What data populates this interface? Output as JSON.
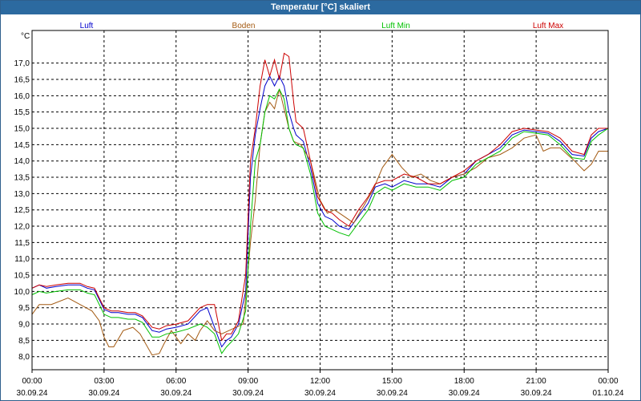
{
  "window": {
    "title": "Temperatur [°C] skaliert"
  },
  "chart_data": {
    "type": "line",
    "title": "Temperatur [°C] skaliert",
    "ylabel": "°C",
    "xlabel": "",
    "ylim": [
      7.6,
      18.0
    ],
    "xlim": [
      0,
      24
    ],
    "grid": true,
    "legend_position": "top",
    "yticks": [
      8.0,
      8.5,
      9.0,
      9.5,
      10.0,
      10.5,
      11.0,
      11.5,
      12.0,
      12.5,
      13.0,
      13.5,
      14.0,
      14.5,
      15.0,
      15.5,
      16.0,
      16.5,
      17.0
    ],
    "ytick_labels": [
      "8,0",
      "8,5",
      "9,0",
      "9,5",
      "10,0",
      "10,5",
      "11,0",
      "11,5",
      "12,0",
      "12,5",
      "13,0",
      "13,5",
      "14,0",
      "14,5",
      "15,0",
      "15,5",
      "16,0",
      "16,5",
      "17,0"
    ],
    "xticks": [
      {
        "time": "00:00",
        "date": "30.09.24"
      },
      {
        "time": "03:00",
        "date": "30.09.24"
      },
      {
        "time": "06:00",
        "date": "30.09.24"
      },
      {
        "time": "09:00",
        "date": "30.09.24"
      },
      {
        "time": "12:00",
        "date": "30.09.24"
      },
      {
        "time": "15:00",
        "date": "30.09.24"
      },
      {
        "time": "18:00",
        "date": "30.09.24"
      },
      {
        "time": "21:00",
        "date": "30.09.24"
      },
      {
        "time": "00:00",
        "date": "01.10.24"
      }
    ],
    "series": [
      {
        "name": "Luft",
        "color": "#0000cc",
        "x": [
          0,
          0.3,
          0.6,
          1.0,
          1.5,
          2.0,
          2.3,
          2.6,
          3.0,
          3.3,
          3.6,
          4.0,
          4.3,
          4.6,
          5.0,
          5.3,
          5.6,
          6.0,
          6.5,
          7.0,
          7.3,
          7.6,
          7.9,
          8.1,
          8.3,
          8.6,
          8.9,
          9.1,
          9.3,
          9.5,
          9.7,
          9.9,
          10.1,
          10.3,
          10.5,
          10.7,
          10.9,
          11.0,
          11.3,
          11.6,
          11.9,
          12.2,
          12.5,
          12.8,
          13.2,
          13.6,
          14.0,
          14.3,
          14.7,
          15.0,
          15.5,
          16.0,
          16.5,
          17.0,
          17.5,
          18.0,
          18.5,
          19.0,
          19.5,
          20.0,
          20.5,
          21.0,
          21.5,
          22.0,
          22.5,
          23.0,
          23.3,
          23.6,
          24.0
        ],
        "y": [
          10.1,
          10.2,
          10.1,
          10.15,
          10.2,
          10.2,
          10.1,
          10.05,
          9.45,
          9.35,
          9.35,
          9.3,
          9.3,
          9.2,
          8.8,
          8.75,
          8.85,
          8.9,
          9.0,
          9.4,
          9.5,
          8.9,
          8.3,
          8.5,
          8.6,
          9.0,
          10.0,
          13.5,
          14.8,
          15.6,
          16.3,
          16.6,
          16.3,
          16.6,
          16.3,
          15.5,
          15.0,
          14.8,
          14.6,
          13.8,
          12.7,
          12.3,
          12.2,
          12.0,
          11.9,
          12.3,
          12.7,
          13.2,
          13.3,
          13.2,
          13.4,
          13.3,
          13.3,
          13.2,
          13.5,
          13.6,
          14.0,
          14.2,
          14.4,
          14.8,
          14.95,
          14.9,
          14.85,
          14.6,
          14.2,
          14.15,
          14.7,
          14.9,
          15.0
        ]
      },
      {
        "name": "Boden",
        "color": "#a35a12",
        "x": [
          0,
          0.3,
          0.8,
          1.5,
          2.0,
          2.5,
          2.8,
          3.0,
          3.2,
          3.4,
          3.8,
          4.2,
          4.5,
          5.0,
          5.3,
          5.5,
          5.8,
          6.0,
          6.2,
          6.5,
          6.8,
          7.0,
          7.3,
          7.6,
          7.9,
          8.2,
          8.5,
          8.8,
          9.1,
          9.3,
          9.5,
          9.7,
          9.9,
          10.1,
          10.3,
          10.5,
          10.7,
          10.9,
          11.2,
          11.6,
          12.0,
          12.3,
          12.6,
          13.0,
          13.4,
          13.8,
          14.2,
          14.6,
          15.0,
          15.4,
          15.8,
          16.2,
          16.6,
          17.0,
          17.5,
          18.0,
          18.5,
          19.0,
          19.5,
          20.0,
          20.5,
          21.0,
          21.3,
          21.6,
          22.0,
          22.3,
          22.6,
          23.0,
          23.3,
          23.6,
          24.0
        ],
        "y": [
          9.3,
          9.6,
          9.6,
          9.8,
          9.6,
          9.4,
          9.1,
          8.6,
          8.3,
          8.3,
          8.8,
          8.9,
          8.7,
          8.05,
          8.1,
          8.4,
          8.8,
          8.6,
          8.4,
          8.7,
          8.5,
          8.8,
          9.1,
          8.8,
          8.7,
          8.8,
          8.9,
          9.0,
          11.5,
          12.8,
          14.5,
          15.5,
          15.8,
          15.6,
          16.2,
          15.6,
          15.0,
          14.6,
          14.5,
          14.0,
          12.8,
          12.4,
          12.5,
          12.3,
          12.1,
          12.6,
          13.1,
          13.8,
          14.2,
          13.8,
          13.5,
          13.6,
          13.4,
          13.3,
          13.5,
          13.6,
          13.8,
          14.1,
          14.2,
          14.4,
          14.7,
          14.8,
          14.3,
          14.4,
          14.4,
          14.2,
          14.0,
          13.7,
          13.9,
          14.3,
          14.3
        ]
      },
      {
        "name": "Luft Min",
        "color": "#00c000",
        "x": [
          0,
          0.3,
          0.6,
          1.0,
          1.5,
          2.0,
          2.3,
          2.6,
          3.0,
          3.3,
          3.6,
          4.0,
          4.3,
          4.6,
          5.0,
          5.3,
          5.6,
          6.0,
          6.5,
          7.0,
          7.3,
          7.6,
          7.9,
          8.1,
          8.3,
          8.6,
          8.9,
          9.1,
          9.3,
          9.5,
          9.7,
          9.9,
          10.1,
          10.3,
          10.5,
          10.7,
          10.9,
          11.0,
          11.3,
          11.6,
          11.9,
          12.2,
          12.5,
          12.8,
          13.2,
          13.6,
          14.0,
          14.3,
          14.7,
          15.0,
          15.5,
          16.0,
          16.5,
          17.0,
          17.5,
          18.0,
          18.5,
          19.0,
          19.5,
          20.0,
          20.5,
          21.0,
          21.5,
          22.0,
          22.5,
          23.0,
          23.3,
          23.6,
          24.0
        ],
        "y": [
          9.9,
          10.0,
          9.95,
          10.0,
          10.05,
          10.05,
          9.95,
          9.9,
          9.3,
          9.2,
          9.2,
          9.15,
          9.15,
          9.05,
          8.6,
          8.6,
          8.7,
          8.75,
          8.85,
          9.0,
          8.9,
          8.7,
          8.1,
          8.3,
          8.45,
          8.7,
          9.4,
          12.0,
          14.0,
          14.5,
          15.5,
          16.0,
          15.9,
          16.2,
          15.9,
          15.0,
          14.6,
          14.5,
          14.4,
          13.6,
          12.4,
          12.0,
          11.9,
          11.8,
          11.7,
          12.1,
          12.5,
          13.0,
          13.2,
          13.1,
          13.3,
          13.2,
          13.2,
          13.1,
          13.4,
          13.5,
          13.9,
          14.1,
          14.3,
          14.7,
          14.9,
          14.85,
          14.8,
          14.5,
          14.1,
          14.05,
          14.6,
          14.8,
          15.0
        ]
      },
      {
        "name": "Luft Max",
        "color": "#cc0000",
        "x": [
          0,
          0.3,
          0.6,
          1.0,
          1.5,
          2.0,
          2.3,
          2.6,
          3.0,
          3.3,
          3.6,
          4.0,
          4.3,
          4.6,
          5.0,
          5.3,
          5.6,
          6.0,
          6.5,
          7.0,
          7.3,
          7.6,
          7.9,
          8.1,
          8.3,
          8.6,
          8.9,
          9.1,
          9.3,
          9.5,
          9.7,
          9.9,
          10.1,
          10.3,
          10.5,
          10.7,
          10.9,
          11.0,
          11.3,
          11.6,
          11.9,
          12.2,
          12.5,
          12.8,
          13.2,
          13.6,
          14.0,
          14.3,
          14.7,
          15.0,
          15.5,
          16.0,
          16.5,
          17.0,
          17.5,
          18.0,
          18.5,
          19.0,
          19.5,
          20.0,
          20.5,
          21.0,
          21.5,
          22.0,
          22.5,
          23.0,
          23.3,
          23.6,
          24.0
        ],
        "y": [
          10.1,
          10.2,
          10.15,
          10.2,
          10.25,
          10.25,
          10.15,
          10.1,
          9.5,
          9.4,
          9.4,
          9.35,
          9.35,
          9.25,
          8.9,
          8.85,
          8.95,
          9.0,
          9.1,
          9.5,
          9.6,
          9.6,
          8.5,
          8.7,
          8.7,
          9.1,
          10.5,
          14.0,
          15.0,
          16.3,
          17.1,
          16.6,
          17.1,
          16.5,
          17.3,
          17.2,
          15.8,
          15.2,
          15.0,
          14.0,
          12.9,
          12.5,
          12.4,
          12.2,
          12.0,
          12.5,
          12.9,
          13.3,
          13.4,
          13.4,
          13.6,
          13.5,
          13.3,
          13.3,
          13.5,
          13.7,
          14.0,
          14.2,
          14.5,
          14.9,
          15.0,
          14.95,
          14.9,
          14.7,
          14.3,
          14.2,
          14.8,
          15.0,
          15.0
        ]
      }
    ]
  }
}
